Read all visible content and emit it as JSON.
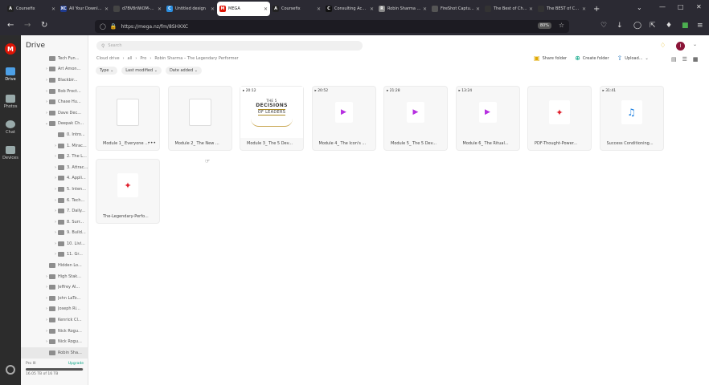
{
  "browser": {
    "tabs": [
      {
        "label": "Coursefix",
        "icon": "A",
        "color": "#222",
        "active": false
      },
      {
        "label": "All Your Downloads...",
        "icon": "XC",
        "color": "#1f3b8f",
        "active": false
      },
      {
        "label": "d7BV8rWiOM-2-0-y-0...",
        "icon": "",
        "color": "#444",
        "active": false
      },
      {
        "label": "Untitled design",
        "icon": "C",
        "color": "#2b8ee0",
        "active": false
      },
      {
        "label": "MEGA",
        "icon": "M",
        "color": "#dd1405",
        "active": true
      },
      {
        "label": "Coursefix",
        "icon": "A",
        "color": "#222",
        "active": false
      },
      {
        "label": "Consulting Accele...",
        "icon": "C",
        "color": "#111",
        "active": false
      },
      {
        "label": "Robin Sharma – Th...",
        "icon": "R",
        "color": "#888",
        "active": false
      },
      {
        "label": "FireShot Capture 021...",
        "icon": "",
        "color": "#555",
        "active": false
      },
      {
        "label": "The Best of Chan...",
        "icon": "",
        "color": "#333",
        "active": false
      },
      {
        "label": "The BEST of Chan...",
        "icon": "",
        "color": "#333",
        "active": false
      }
    ],
    "url": "https://mega.nz/fm/8SHXXC",
    "zoom": "80%"
  },
  "rail": {
    "logo": "M",
    "items": [
      {
        "label": "Drive",
        "active": true
      },
      {
        "label": "Photos",
        "active": false
      },
      {
        "label": "Chat",
        "active": false
      },
      {
        "label": "Devices",
        "active": false
      }
    ]
  },
  "sidebar": {
    "title": "Drive",
    "tree": [
      {
        "label": "Tech Fun...",
        "depth": 1,
        "arrow": ""
      },
      {
        "label": "Art Amon...",
        "depth": 1,
        "arrow": "›"
      },
      {
        "label": "Blackbir...",
        "depth": 1,
        "arrow": "›"
      },
      {
        "label": "Bob Proct...",
        "depth": 1,
        "arrow": "›"
      },
      {
        "label": "Chase Hu...",
        "depth": 1,
        "arrow": "›"
      },
      {
        "label": "Dave Dec...",
        "depth": 1,
        "arrow": "›"
      },
      {
        "label": "Deepak Ch...",
        "depth": 1,
        "arrow": "⌄"
      },
      {
        "label": "0. Intro...",
        "depth": 2,
        "arrow": ""
      },
      {
        "label": "1. Mirac...",
        "depth": 2,
        "arrow": "›"
      },
      {
        "label": "2. The L...",
        "depth": 2,
        "arrow": "›"
      },
      {
        "label": "3. Attract...",
        "depth": 2,
        "arrow": "›"
      },
      {
        "label": "4. Appli...",
        "depth": 2,
        "arrow": "›"
      },
      {
        "label": "5. Inten...",
        "depth": 2,
        "arrow": "›"
      },
      {
        "label": "6. Tech...",
        "depth": 2,
        "arrow": "›"
      },
      {
        "label": "7. Daily...",
        "depth": 2,
        "arrow": "›"
      },
      {
        "label": "8. Surr...",
        "depth": 2,
        "arrow": "›"
      },
      {
        "label": "9. Build...",
        "depth": 2,
        "arrow": "›"
      },
      {
        "label": "10. Livi...",
        "depth": 2,
        "arrow": "›"
      },
      {
        "label": "11. Gr...",
        "depth": 2,
        "arrow": "›"
      },
      {
        "label": "Hidden Lo...",
        "depth": 1,
        "arrow": ""
      },
      {
        "label": "High Stak...",
        "depth": 1,
        "arrow": "›"
      },
      {
        "label": "Jeffrey Al...",
        "depth": 1,
        "arrow": "›"
      },
      {
        "label": "John LaTo...",
        "depth": 1,
        "arrow": "›"
      },
      {
        "label": "Joseph Ri...",
        "depth": 1,
        "arrow": "›"
      },
      {
        "label": "Kenrick Cl...",
        "depth": 1,
        "arrow": "›"
      },
      {
        "label": "Nick Rogu...",
        "depth": 1,
        "arrow": "›"
      },
      {
        "label": "Nick Rogu...",
        "depth": 1,
        "arrow": "›"
      },
      {
        "label": "Robin Sha...",
        "depth": 1,
        "arrow": "",
        "selected": true
      }
    ],
    "storage": {
      "plan": "Pro III",
      "upgrade": "Upgrade",
      "used_text": "16.05 TB of 16 TB",
      "fraction": 0.98
    }
  },
  "main": {
    "search_placeholder": "Search",
    "breadcrumbs": [
      "Cloud drive",
      "›",
      "all",
      "›",
      "Pro",
      "›",
      "Robin Sharma – The Legendary Performer"
    ],
    "actions": {
      "share": "Share folder",
      "create": "Create folder",
      "upload": "Upload..."
    },
    "filters": [
      "Type",
      "Last modified",
      "Date added"
    ],
    "files": [
      {
        "name": "Module 1_ Everyone ...",
        "kind": "doc",
        "duration": ""
      },
      {
        "name": "Module 2_ The New ...",
        "kind": "doc",
        "duration": ""
      },
      {
        "name": "Module 3_ The 5 Dev...",
        "kind": "image",
        "duration": "20:12"
      },
      {
        "name": "Module 4_ The Icon's ...",
        "kind": "video",
        "duration": "20:52"
      },
      {
        "name": "Module 5_ The 5 Dev...",
        "kind": "video",
        "duration": "21:28"
      },
      {
        "name": "Module 6_ The Ritual...",
        "kind": "video",
        "duration": "13:24"
      },
      {
        "name": "PDF-Thought-Power...",
        "kind": "pdf",
        "duration": ""
      },
      {
        "name": "Success Conditioning...",
        "kind": "audio",
        "duration": "31:41"
      },
      {
        "name": "The-Legendary-Perfo...",
        "kind": "pdf",
        "duration": ""
      }
    ],
    "thumb_text": {
      "line1": "THE 5",
      "line2": "DECISIONS",
      "line3": "OF LEADERS"
    },
    "more": "•••"
  }
}
